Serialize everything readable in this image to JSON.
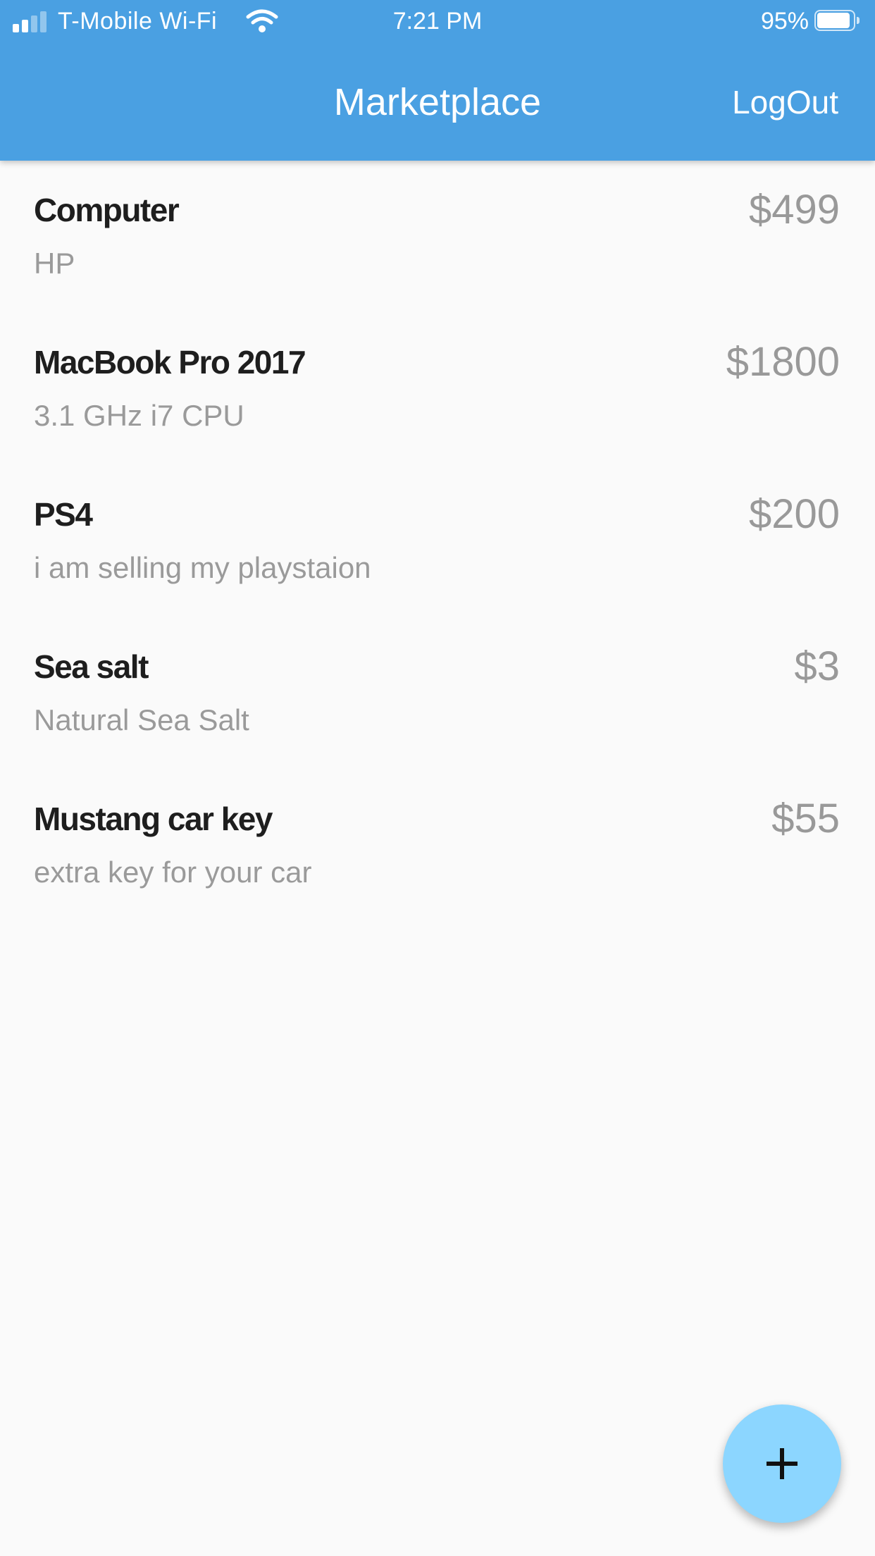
{
  "status_bar": {
    "carrier": "T-Mobile Wi-Fi",
    "time": "7:21 PM",
    "battery": "95%",
    "battery_level": 0.95,
    "signal_bars": 2,
    "signal_bars_total": 4
  },
  "header": {
    "title": "Marketplace",
    "logout_label": "LogOut"
  },
  "colors": {
    "app_bar": "#4aa0e2",
    "fab": "#8cd6ff",
    "background": "#fafafa",
    "item_name": "#1e1e1e",
    "secondary_text": "#9a9a9a"
  },
  "listings": [
    {
      "name": "Computer",
      "description": "HP",
      "price": "$499"
    },
    {
      "name": "MacBook Pro 2017",
      "description": "3.1 GHz i7 CPU",
      "price": "$1800"
    },
    {
      "name": "PS4",
      "description": "i am selling my playstaion",
      "price": "$200"
    },
    {
      "name": "Sea salt",
      "description": "Natural Sea Salt",
      "price": "$3"
    },
    {
      "name": "Mustang car key",
      "description": "extra key for your car",
      "price": "$55"
    }
  ],
  "fab": {
    "icon": "plus-icon"
  }
}
